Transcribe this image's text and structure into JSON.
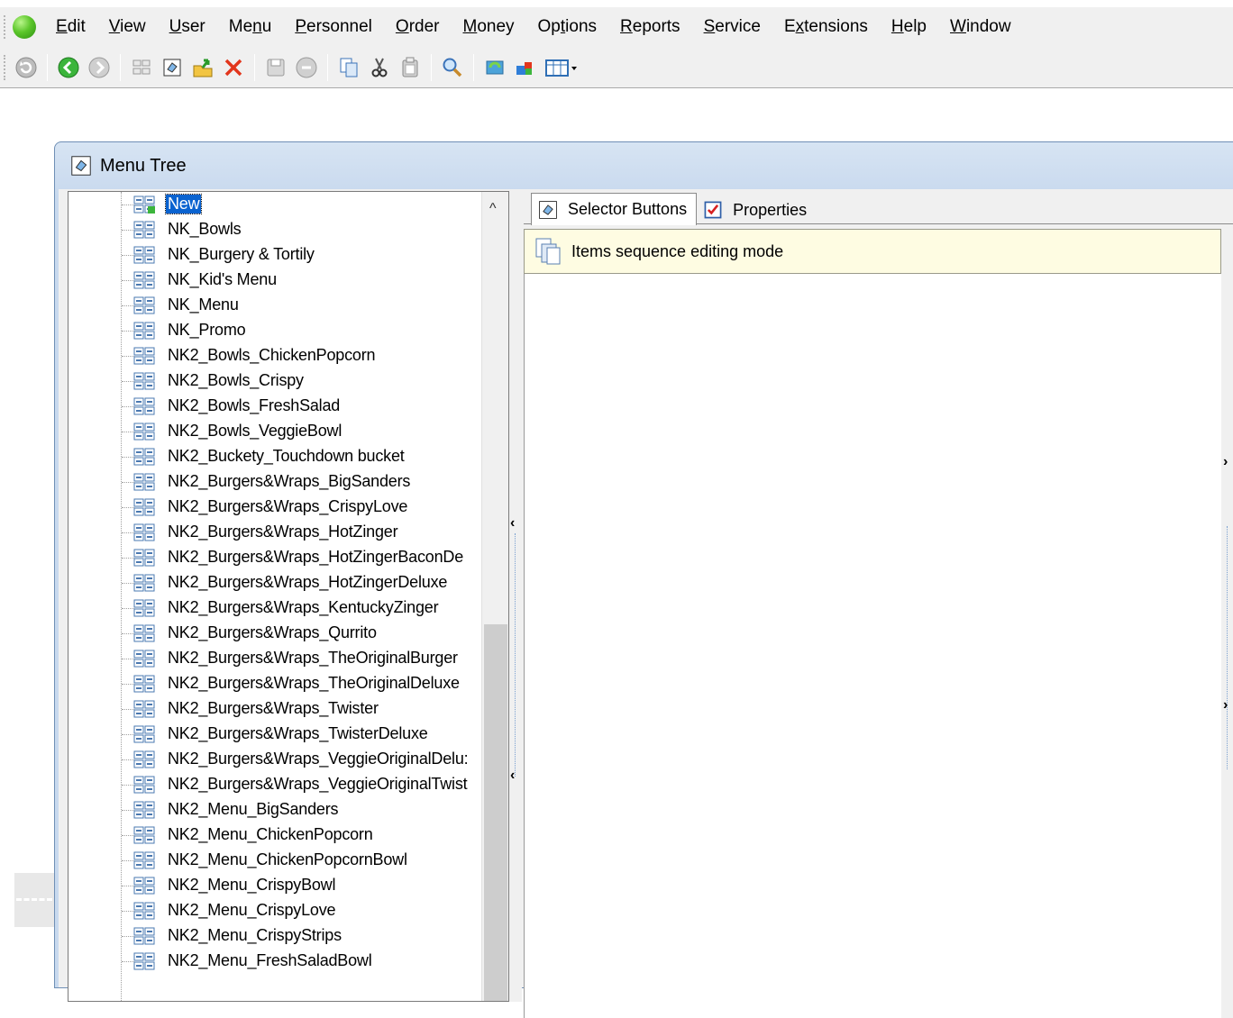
{
  "menubar": {
    "items": [
      {
        "pre": "",
        "u": "E",
        "post": "dit"
      },
      {
        "pre": "",
        "u": "V",
        "post": "iew"
      },
      {
        "pre": "",
        "u": "U",
        "post": "ser"
      },
      {
        "pre": "Me",
        "u": "n",
        "post": "u"
      },
      {
        "pre": "",
        "u": "P",
        "post": "ersonnel"
      },
      {
        "pre": "",
        "u": "O",
        "post": "rder"
      },
      {
        "pre": "",
        "u": "M",
        "post": "oney"
      },
      {
        "pre": "Op",
        "u": "t",
        "post": "ions"
      },
      {
        "pre": "",
        "u": "R",
        "post": "eports"
      },
      {
        "pre": "",
        "u": "S",
        "post": "ervice"
      },
      {
        "pre": "E",
        "u": "x",
        "post": "tensions"
      },
      {
        "pre": "",
        "u": "H",
        "post": "elp"
      },
      {
        "pre": "",
        "u": "W",
        "post": "indow"
      }
    ]
  },
  "toolbar": {
    "icons": [
      "refresh-icon",
      "back-icon",
      "forward-icon",
      "grid-icon",
      "cube-icon",
      "export-icon",
      "delete-icon",
      "save-icon",
      "undo-icon",
      "copy-icon",
      "cut-icon",
      "paste-icon",
      "search-icon",
      "sync-icon",
      "puzzle-icon",
      "table-dropdown-icon"
    ]
  },
  "window": {
    "title": "Menu Tree"
  },
  "tree": {
    "items": [
      "New",
      "NK_Bowls",
      "NK_Burgery & Tortily",
      "NK_Kid's Menu",
      "NK_Menu",
      "NK_Promo",
      "NK2_Bowls_ChickenPopcorn",
      "NK2_Bowls_Crispy",
      "NK2_Bowls_FreshSalad",
      "NK2_Bowls_VeggieBowl",
      "NK2_Buckety_Touchdown bucket",
      "NK2_Burgers&Wraps_BigSanders",
      "NK2_Burgers&Wraps_CrispyLove",
      "NK2_Burgers&Wraps_HotZinger",
      "NK2_Burgers&Wraps_HotZingerBaconDe",
      "NK2_Burgers&Wraps_HotZingerDeluxe",
      "NK2_Burgers&Wraps_KentuckyZinger",
      "NK2_Burgers&Wraps_Qurrito",
      "NK2_Burgers&Wraps_TheOriginalBurger",
      "NK2_Burgers&Wraps_TheOriginalDeluxe",
      "NK2_Burgers&Wraps_Twister",
      "NK2_Burgers&Wraps_TwisterDeluxe",
      "NK2_Burgers&Wraps_VeggieOriginalDelu:",
      "NK2_Burgers&Wraps_VeggieOriginalTwist",
      "NK2_Menu_BigSanders",
      "NK2_Menu_ChickenPopcorn",
      "NK2_Menu_ChickenPopcornBowl",
      "NK2_Menu_CrispyBowl",
      "NK2_Menu_CrispyLove",
      "NK2_Menu_CrispyStrips",
      "NK2_Menu_FreshSaladBowl"
    ],
    "selected_index": 0
  },
  "tabs": [
    {
      "label": "Selector Buttons",
      "icon": "cube-icon",
      "active": true
    },
    {
      "label": "Properties",
      "icon": "checklist-icon",
      "active": false
    }
  ],
  "info_bar": {
    "text": "Items sequence editing mode"
  },
  "colors": {
    "selection": "#0a63d0",
    "info_bg": "#fefce2",
    "titlebar": "#d7e4f3"
  }
}
